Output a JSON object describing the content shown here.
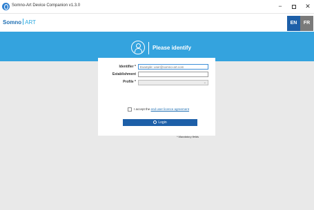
{
  "window": {
    "title": "Somno-Art Device Companion v1.3.0",
    "minimize": "−",
    "close": "✕"
  },
  "header": {
    "logo_main": "Somno",
    "logo_accent": "ART",
    "languages": [
      {
        "label": "EN",
        "active": true
      },
      {
        "label": "FR",
        "active": false
      }
    ]
  },
  "identify": {
    "heading": "Please identify",
    "fields": {
      "identifier": {
        "label": "Identifier *",
        "value": "",
        "placeholder": "Example: user@somno-art.com"
      },
      "establishment": {
        "label": "Establishment",
        "value": ""
      },
      "profile": {
        "label": "Profile *",
        "value": ""
      }
    },
    "accept_prefix": "I accept the ",
    "accept_link": "end user licence agreement",
    "login_label": "Login",
    "mandatory_note": "* Mandatory fields"
  },
  "colors": {
    "banner": "#34a3de",
    "primary": "#1d5fa8",
    "background": "#e9e9e9"
  }
}
